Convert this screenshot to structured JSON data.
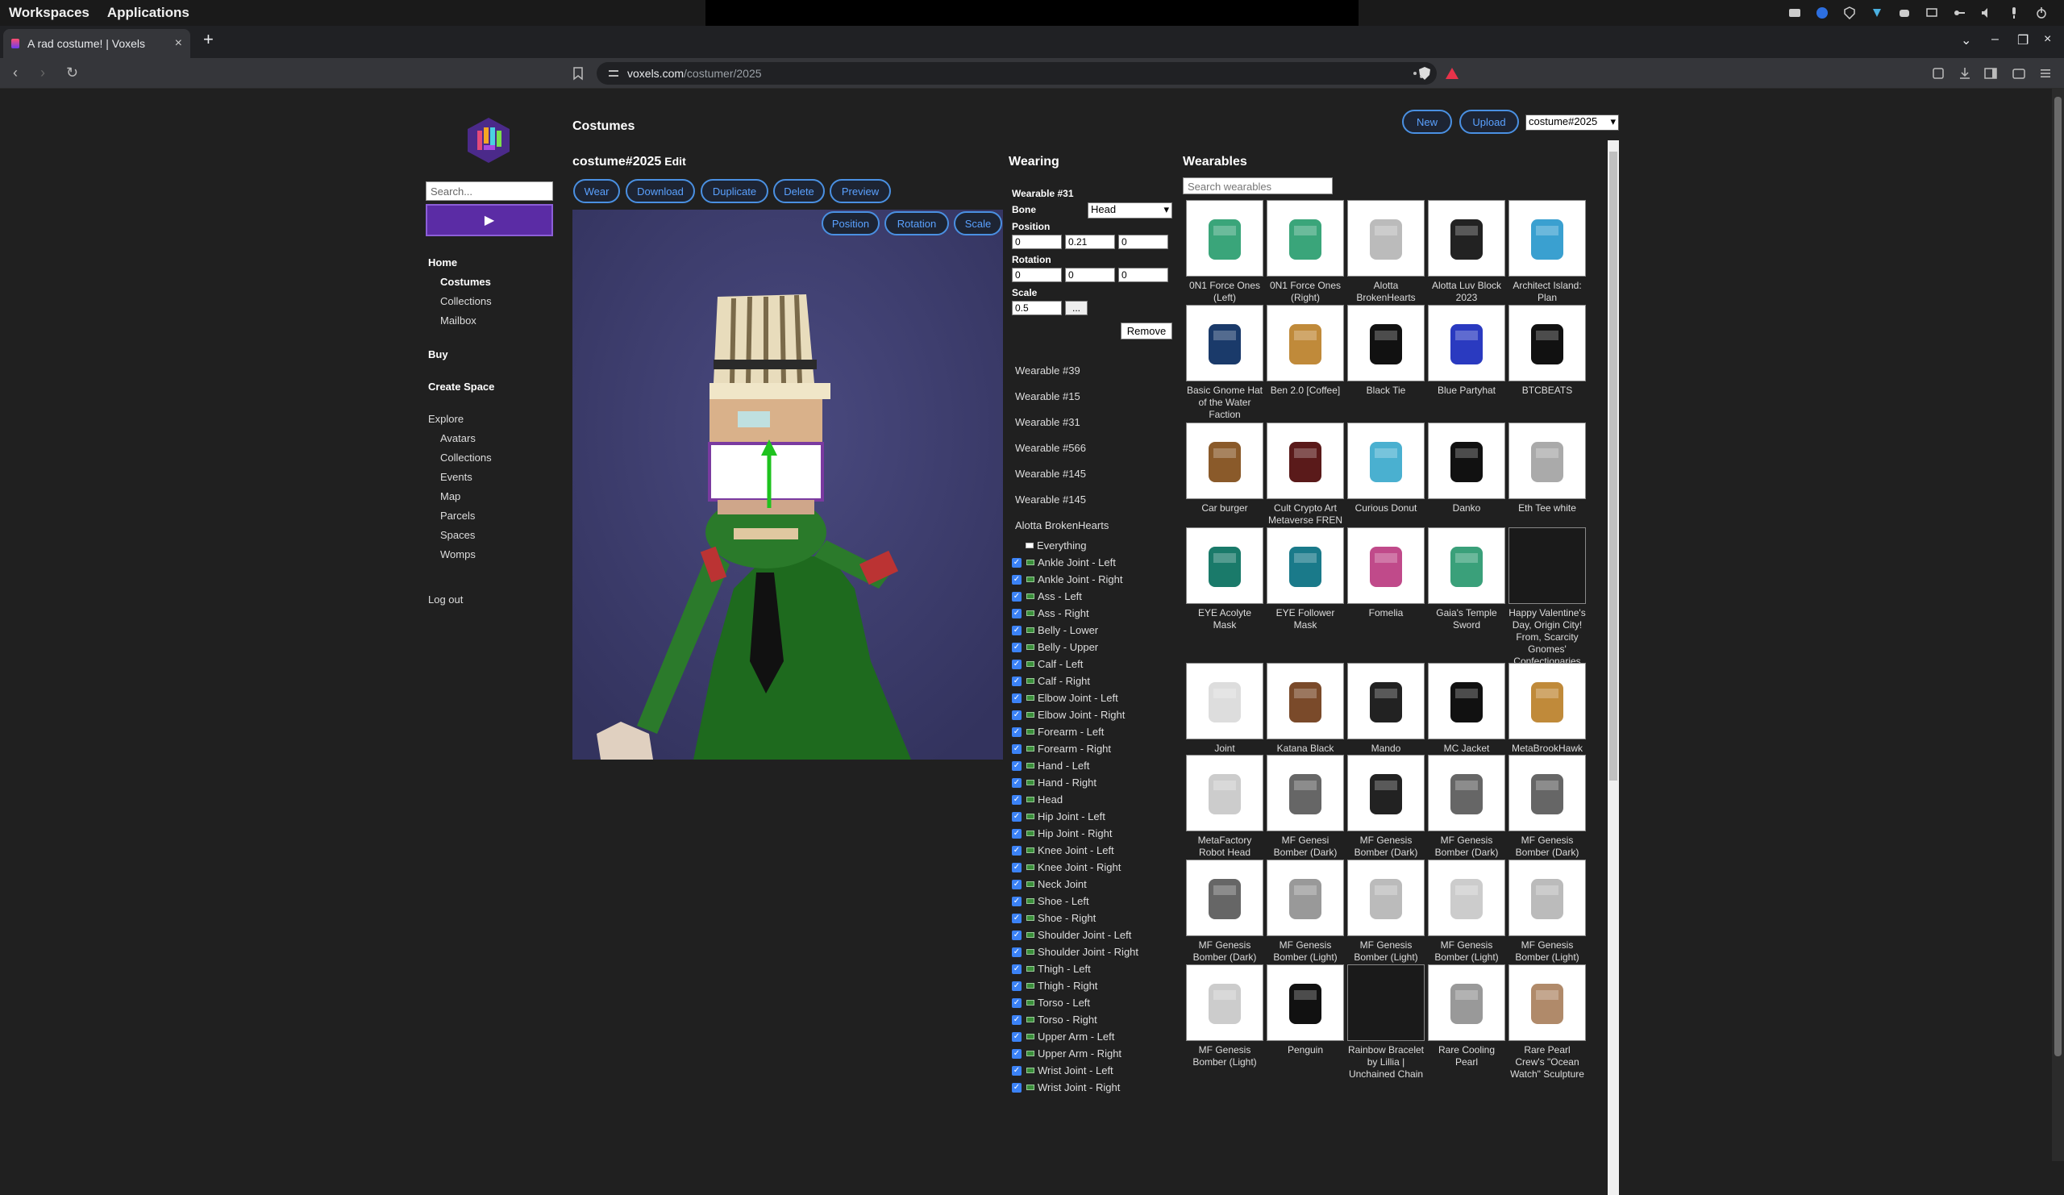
{
  "topbar": {
    "workspaces": "Workspaces",
    "applications": "Applications"
  },
  "browser": {
    "tab_title": "A rad costume! | Voxels",
    "url_host": "voxels.com",
    "url_path": "/costumer/2025"
  },
  "sidebar": {
    "search_placeholder": "Search...",
    "play_label": "▶",
    "items": [
      {
        "label": "Home",
        "bold": true
      },
      {
        "label": "Costumes",
        "bold": true
      },
      {
        "label": "Collections"
      },
      {
        "label": "Mailbox"
      },
      {
        "label": "Buy",
        "bold": true
      },
      {
        "label": "Create Space",
        "bold": true
      },
      {
        "label": "Explore"
      },
      {
        "label": "Avatars"
      },
      {
        "label": "Collections"
      },
      {
        "label": "Events"
      },
      {
        "label": "Map"
      },
      {
        "label": "Parcels"
      },
      {
        "label": "Spaces"
      },
      {
        "label": "Womps"
      },
      {
        "label": "Log out"
      }
    ]
  },
  "header": {
    "title": "Costumes",
    "new_label": "New",
    "upload_label": "Upload",
    "costume_select": "costume#2025"
  },
  "costume": {
    "name": "costume#2025",
    "edit_label": "Edit",
    "actions": [
      "Wear",
      "Download",
      "Duplicate",
      "Delete",
      "Preview"
    ],
    "gizmo_modes": [
      "Position",
      "Rotation",
      "Scale"
    ]
  },
  "wearing": {
    "title": "Wearing",
    "selected": "Wearable #31",
    "bone_label": "Bone",
    "bone_value": "Head",
    "position_label": "Position",
    "position": [
      "0",
      "0.21",
      "0"
    ],
    "rotation_label": "Rotation",
    "rotation": [
      "0",
      "0",
      "0"
    ],
    "scale_label": "Scale",
    "scale": "0.5",
    "scale_more": "...",
    "remove_label": "Remove",
    "list": [
      "Wearable #39",
      "Wearable #15",
      "Wearable #31",
      "Wearable #566",
      "Wearable #145",
      "Wearable #145",
      "Alotta BrokenHearts"
    ],
    "everything_label": "Everything",
    "bones": [
      "Ankle Joint - Left",
      "Ankle Joint - Right",
      "Ass - Left",
      "Ass - Right",
      "Belly - Lower",
      "Belly - Upper",
      "Calf - Left",
      "Calf - Right",
      "Elbow Joint - Left",
      "Elbow Joint - Right",
      "Forearm - Left",
      "Forearm - Right",
      "Hand - Left",
      "Hand - Right",
      "Head",
      "Hip Joint - Left",
      "Hip Joint - Right",
      "Knee Joint - Left",
      "Knee Joint - Right",
      "Neck Joint",
      "Shoe - Left",
      "Shoe - Right",
      "Shoulder Joint - Left",
      "Shoulder Joint - Right",
      "Thigh - Left",
      "Thigh - Right",
      "Torso - Left",
      "Torso - Right",
      "Upper Arm - Left",
      "Upper Arm - Right",
      "Wrist Joint - Left",
      "Wrist Joint - Right"
    ]
  },
  "wearables": {
    "title": "Wearables",
    "search_placeholder": "Search wearables",
    "items": [
      {
        "name": "0N1 Force Ones (Left)",
        "color": "#3aa57a"
      },
      {
        "name": "0N1 Force Ones (Right)",
        "color": "#3aa57a"
      },
      {
        "name": "Alotta BrokenHearts",
        "color": "#bbbbbb"
      },
      {
        "name": "Alotta Luv Block 2023",
        "color": "#222222"
      },
      {
        "name": "Architect Island: Plan",
        "color": "#3aa0d0"
      },
      {
        "name": "Basic Gnome Hat of the Water Faction",
        "color": "#1a3a6a"
      },
      {
        "name": "Ben 2.0 [Coffee]",
        "color": "#c08a3a"
      },
      {
        "name": "Black Tie",
        "color": "#111111"
      },
      {
        "name": "Blue Partyhat",
        "color": "#2a3ac0"
      },
      {
        "name": "BTCBEATS",
        "color": "#111111"
      },
      {
        "name": "Car burger",
        "color": "#8a5a2a"
      },
      {
        "name": "Cult Crypto Art Metaverse FREN",
        "color": "#5a1a1a"
      },
      {
        "name": "Curious Donut",
        "color": "#4ab0d0"
      },
      {
        "name": "Danko",
        "color": "#111111"
      },
      {
        "name": "Eth Tee white",
        "color": "#aaaaaa"
      },
      {
        "name": "EYE Acolyte Mask",
        "color": "#1a7a6a"
      },
      {
        "name": "EYE Follower Mask",
        "color": "#1a7a8a"
      },
      {
        "name": "Fomelia",
        "color": "#c04a8a"
      },
      {
        "name": "Gaia's Temple Sword",
        "color": "#3aa07a"
      },
      {
        "name": "Happy Valentine's Day, Origin City! From, Scarcity Gnomes' Confectionaries",
        "color": "",
        "dark": true
      },
      {
        "name": "Joint",
        "color": "#dddddd"
      },
      {
        "name": "Katana Black",
        "color": "#7a4a2a"
      },
      {
        "name": "Mando",
        "color": "#222222"
      },
      {
        "name": "MC Jacket",
        "color": "#111111"
      },
      {
        "name": "MetaBrookHawk",
        "color": "#c08a3a"
      },
      {
        "name": "MetaFactory Robot Head",
        "color": "#cccccc"
      },
      {
        "name": "MF Genesi Bomber (Dark)",
        "color": "#666666"
      },
      {
        "name": "MF Genesis Bomber (Dark)",
        "color": "#222222"
      },
      {
        "name": "MF Genesis Bomber (Dark)",
        "color": "#666666"
      },
      {
        "name": "MF Genesis Bomber (Dark)",
        "color": "#666666"
      },
      {
        "name": "MF Genesis Bomber (Dark)",
        "color": "#666666"
      },
      {
        "name": "MF Genesis Bomber (Light)",
        "color": "#999999"
      },
      {
        "name": "MF Genesis Bomber (Light)",
        "color": "#bbbbbb"
      },
      {
        "name": "MF Genesis Bomber (Light)",
        "color": "#cccccc"
      },
      {
        "name": "MF Genesis Bomber (Light)",
        "color": "#bbbbbb"
      },
      {
        "name": "MF Genesis Bomber (Light)",
        "color": "#cccccc"
      },
      {
        "name": "Penguin",
        "color": "#111111"
      },
      {
        "name": "Rainbow Bracelet by Lillia | Unchained Chain",
        "color": "",
        "dark": true
      },
      {
        "name": "Rare Cooling Pearl",
        "color": "#999999"
      },
      {
        "name": "Rare Pearl Crew's \"Ocean Watch\" Sculpture",
        "color": "#b08a6a"
      }
    ]
  }
}
